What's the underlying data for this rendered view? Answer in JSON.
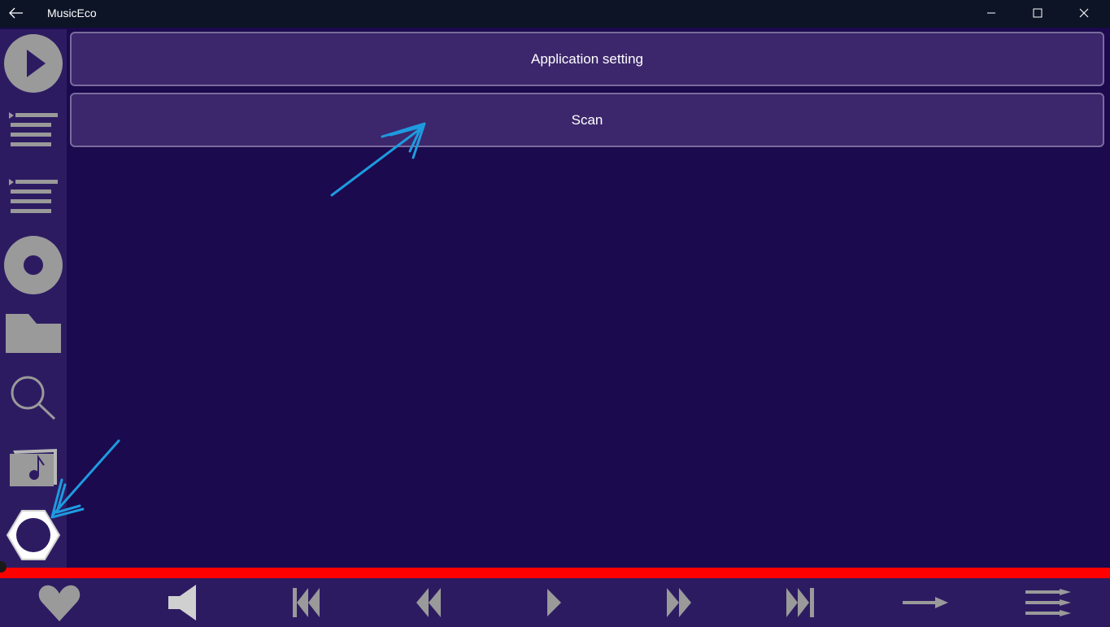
{
  "window": {
    "title": "MusicEco",
    "back_icon": "back-arrow-icon",
    "controls": [
      "minimize-icon",
      "maximize-icon",
      "close-icon"
    ]
  },
  "sidebar": {
    "items": [
      {
        "name": "now-playing",
        "icon": "play-circle-icon"
      },
      {
        "name": "now-playing-list",
        "icon": "playlist-icon"
      },
      {
        "name": "playlists",
        "icon": "list-icon"
      },
      {
        "name": "albums",
        "icon": "disc-icon"
      },
      {
        "name": "folders",
        "icon": "folder-icon"
      },
      {
        "name": "search",
        "icon": "search-icon"
      },
      {
        "name": "music-library",
        "icon": "music-note-icon"
      },
      {
        "name": "settings",
        "icon": "gear-icon",
        "selected": true
      }
    ]
  },
  "main": {
    "buttons": [
      {
        "label": "Application setting"
      },
      {
        "label": "Scan"
      }
    ]
  },
  "progress": {
    "fraction": 1.0,
    "color": "#ff0000"
  },
  "player_controls": [
    {
      "name": "favorite",
      "icon": "heart-icon"
    },
    {
      "name": "volume",
      "icon": "speaker-icon"
    },
    {
      "name": "previous-track",
      "icon": "skip-previous-icon"
    },
    {
      "name": "rewind",
      "icon": "rewind-icon"
    },
    {
      "name": "play",
      "icon": "play-icon"
    },
    {
      "name": "fast-forward",
      "icon": "fast-forward-icon"
    },
    {
      "name": "next-track",
      "icon": "skip-next-icon"
    },
    {
      "name": "repeat-mode",
      "icon": "arrow-right-icon"
    },
    {
      "name": "shuffle-mode",
      "icon": "shuffle-icon"
    }
  ],
  "colors": {
    "background": "#1b0a4d",
    "panel": "#2d1b62",
    "button": "#3c276c",
    "icon": "#9a9a9a",
    "annotation": "#1e9be0"
  }
}
